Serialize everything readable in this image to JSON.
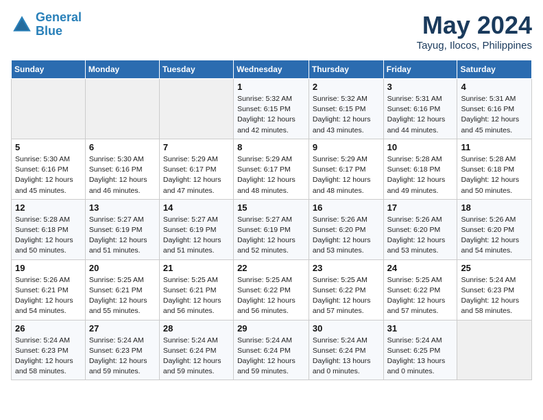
{
  "logo": {
    "line1": "General",
    "line2": "Blue"
  },
  "title": "May 2024",
  "location": "Tayug, Ilocos, Philippines",
  "weekdays": [
    "Sunday",
    "Monday",
    "Tuesday",
    "Wednesday",
    "Thursday",
    "Friday",
    "Saturday"
  ],
  "weeks": [
    [
      {
        "day": "",
        "info": ""
      },
      {
        "day": "",
        "info": ""
      },
      {
        "day": "",
        "info": ""
      },
      {
        "day": "1",
        "info": "Sunrise: 5:32 AM\nSunset: 6:15 PM\nDaylight: 12 hours\nand 42 minutes."
      },
      {
        "day": "2",
        "info": "Sunrise: 5:32 AM\nSunset: 6:15 PM\nDaylight: 12 hours\nand 43 minutes."
      },
      {
        "day": "3",
        "info": "Sunrise: 5:31 AM\nSunset: 6:16 PM\nDaylight: 12 hours\nand 44 minutes."
      },
      {
        "day": "4",
        "info": "Sunrise: 5:31 AM\nSunset: 6:16 PM\nDaylight: 12 hours\nand 45 minutes."
      }
    ],
    [
      {
        "day": "5",
        "info": "Sunrise: 5:30 AM\nSunset: 6:16 PM\nDaylight: 12 hours\nand 45 minutes."
      },
      {
        "day": "6",
        "info": "Sunrise: 5:30 AM\nSunset: 6:16 PM\nDaylight: 12 hours\nand 46 minutes."
      },
      {
        "day": "7",
        "info": "Sunrise: 5:29 AM\nSunset: 6:17 PM\nDaylight: 12 hours\nand 47 minutes."
      },
      {
        "day": "8",
        "info": "Sunrise: 5:29 AM\nSunset: 6:17 PM\nDaylight: 12 hours\nand 48 minutes."
      },
      {
        "day": "9",
        "info": "Sunrise: 5:29 AM\nSunset: 6:17 PM\nDaylight: 12 hours\nand 48 minutes."
      },
      {
        "day": "10",
        "info": "Sunrise: 5:28 AM\nSunset: 6:18 PM\nDaylight: 12 hours\nand 49 minutes."
      },
      {
        "day": "11",
        "info": "Sunrise: 5:28 AM\nSunset: 6:18 PM\nDaylight: 12 hours\nand 50 minutes."
      }
    ],
    [
      {
        "day": "12",
        "info": "Sunrise: 5:28 AM\nSunset: 6:18 PM\nDaylight: 12 hours\nand 50 minutes."
      },
      {
        "day": "13",
        "info": "Sunrise: 5:27 AM\nSunset: 6:19 PM\nDaylight: 12 hours\nand 51 minutes."
      },
      {
        "day": "14",
        "info": "Sunrise: 5:27 AM\nSunset: 6:19 PM\nDaylight: 12 hours\nand 51 minutes."
      },
      {
        "day": "15",
        "info": "Sunrise: 5:27 AM\nSunset: 6:19 PM\nDaylight: 12 hours\nand 52 minutes."
      },
      {
        "day": "16",
        "info": "Sunrise: 5:26 AM\nSunset: 6:20 PM\nDaylight: 12 hours\nand 53 minutes."
      },
      {
        "day": "17",
        "info": "Sunrise: 5:26 AM\nSunset: 6:20 PM\nDaylight: 12 hours\nand 53 minutes."
      },
      {
        "day": "18",
        "info": "Sunrise: 5:26 AM\nSunset: 6:20 PM\nDaylight: 12 hours\nand 54 minutes."
      }
    ],
    [
      {
        "day": "19",
        "info": "Sunrise: 5:26 AM\nSunset: 6:21 PM\nDaylight: 12 hours\nand 54 minutes."
      },
      {
        "day": "20",
        "info": "Sunrise: 5:25 AM\nSunset: 6:21 PM\nDaylight: 12 hours\nand 55 minutes."
      },
      {
        "day": "21",
        "info": "Sunrise: 5:25 AM\nSunset: 6:21 PM\nDaylight: 12 hours\nand 56 minutes."
      },
      {
        "day": "22",
        "info": "Sunrise: 5:25 AM\nSunset: 6:22 PM\nDaylight: 12 hours\nand 56 minutes."
      },
      {
        "day": "23",
        "info": "Sunrise: 5:25 AM\nSunset: 6:22 PM\nDaylight: 12 hours\nand 57 minutes."
      },
      {
        "day": "24",
        "info": "Sunrise: 5:25 AM\nSunset: 6:22 PM\nDaylight: 12 hours\nand 57 minutes."
      },
      {
        "day": "25",
        "info": "Sunrise: 5:24 AM\nSunset: 6:23 PM\nDaylight: 12 hours\nand 58 minutes."
      }
    ],
    [
      {
        "day": "26",
        "info": "Sunrise: 5:24 AM\nSunset: 6:23 PM\nDaylight: 12 hours\nand 58 minutes."
      },
      {
        "day": "27",
        "info": "Sunrise: 5:24 AM\nSunset: 6:23 PM\nDaylight: 12 hours\nand 59 minutes."
      },
      {
        "day": "28",
        "info": "Sunrise: 5:24 AM\nSunset: 6:24 PM\nDaylight: 12 hours\nand 59 minutes."
      },
      {
        "day": "29",
        "info": "Sunrise: 5:24 AM\nSunset: 6:24 PM\nDaylight: 12 hours\nand 59 minutes."
      },
      {
        "day": "30",
        "info": "Sunrise: 5:24 AM\nSunset: 6:24 PM\nDaylight: 13 hours\nand 0 minutes."
      },
      {
        "day": "31",
        "info": "Sunrise: 5:24 AM\nSunset: 6:25 PM\nDaylight: 13 hours\nand 0 minutes."
      },
      {
        "day": "",
        "info": ""
      }
    ]
  ]
}
